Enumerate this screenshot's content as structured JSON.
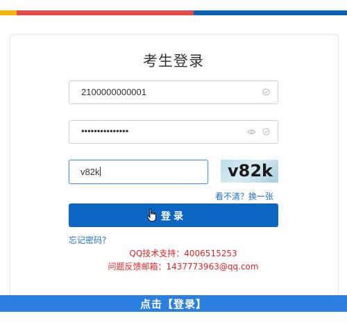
{
  "top_stripe_colors": {
    "yellow": "#f5b400",
    "red": "#e8484a",
    "blue": "#0a62b8"
  },
  "login_form": {
    "title": "考生登录",
    "username_value": "2100000000001",
    "password_masked": "•••••••••••••••",
    "captcha_value": "v82k",
    "captcha_image_text": "v82k",
    "refresh_captcha_label": "看不清？换一张",
    "login_button_label": "登录",
    "forgot_password_label": "忘记密码?",
    "accent_color": "#0b65c2"
  },
  "support": {
    "qq_line": "QQ技术支持：4006515253",
    "mail_line": "问题反馈邮箱：1437773963@qq.com"
  },
  "caption": {
    "text": "点击【登录】"
  },
  "icons": {
    "username_status": "check-circle-icon",
    "password_visibility": "eye-icon",
    "password_status": "check-circle-icon",
    "cursor": "hand-pointer-icon"
  }
}
